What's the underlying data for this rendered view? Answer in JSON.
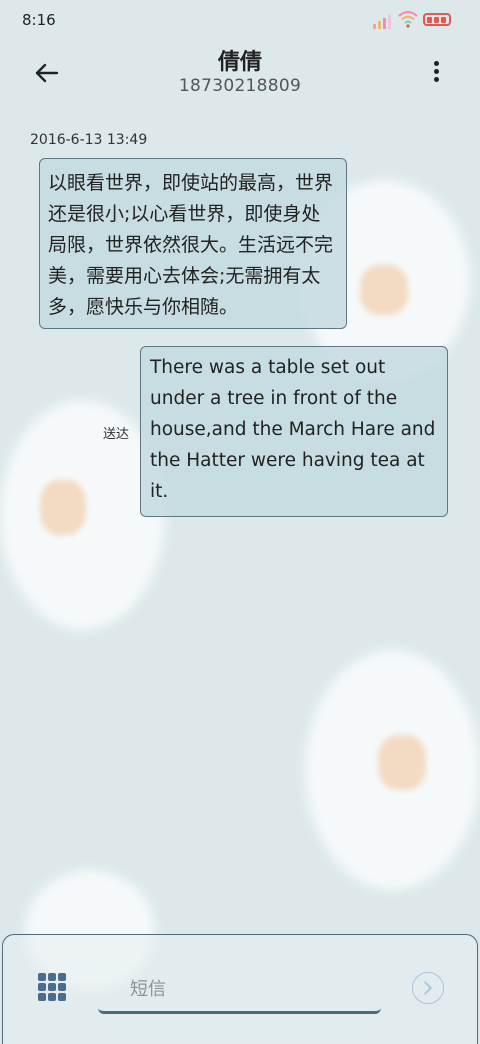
{
  "status_bar": {
    "time": "8:16"
  },
  "header": {
    "contact_name": "倩倩",
    "contact_number": "18730218809"
  },
  "conversation": {
    "timestamp": "2016-6-13 13:49",
    "messages": [
      {
        "direction": "incoming",
        "text": "以眼看世界，即使站的最高，世界还是很小;以心看世界，即使身处局限，世界依然很大。生活远不完美，需要用心去体会;无需拥有太多，愿快乐与你相随。"
      },
      {
        "direction": "outgoing",
        "text": "There was a table set out under a tree in front of the house,and the March Hare and the Hatter were having tea at it.",
        "status": "送达"
      }
    ]
  },
  "composer": {
    "placeholder": "短信",
    "value": ""
  },
  "icons": [
    "signal-icon",
    "wifi-icon",
    "battery-icon",
    "back-arrow-icon",
    "more-vert-icon",
    "apps-grid-icon",
    "send-icon"
  ],
  "colors": {
    "background": "#dce8ea",
    "bubble_border": "#5d7785",
    "bubble_fill": "#c4dae0",
    "battery": "#e05a4f",
    "send_icon": "#a9c4de"
  }
}
